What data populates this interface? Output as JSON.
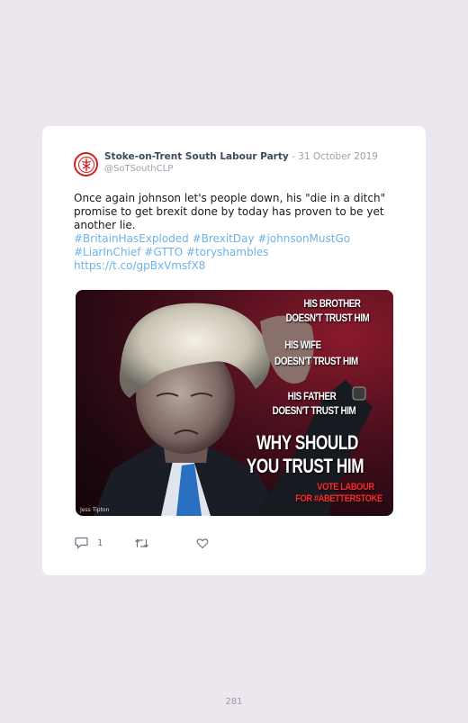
{
  "tweet": {
    "author_name": "Stoke-on-Trent South Labour Party",
    "separator": " - ",
    "date": "31 October 2019",
    "handle": "@SoTSouthCLP",
    "text": "Once again johnson let's people down, his \"die in a ditch\" promise to get brexit done by today has proven to be yet another lie.",
    "hashtags": [
      "#BritainHasExploded",
      "#BrexitDay",
      "#johnsonMustGo",
      "#LiarInChief",
      "#GTTO",
      "#toryshambles"
    ],
    "link": "https://t.co/gpBxVmsfX8",
    "avatar_icon": "labour-logo-icon"
  },
  "media": {
    "lines": [
      "HIS BROTHER",
      "DOESN'T TRUST HIM",
      "HIS WIFE",
      "DOESN'T TRUST HIM",
      "HIS FATHER",
      "DOESN'T TRUST HIM",
      "WHY SHOULD",
      "YOU  TRUST HIM",
      "VOTE LABOUR",
      "FOR #ABETTERSTOKE"
    ],
    "credit": "Jess Tipton"
  },
  "actions": {
    "reply_count": "1",
    "reply_icon": "reply-icon",
    "retweet_icon": "retweet-icon",
    "like_icon": "heart-icon"
  },
  "page_number": "281",
  "colors": {
    "background": "#ece7ee",
    "card": "#ffffff",
    "link": "#6cb3e8",
    "labour_red": "#d21f1f"
  }
}
